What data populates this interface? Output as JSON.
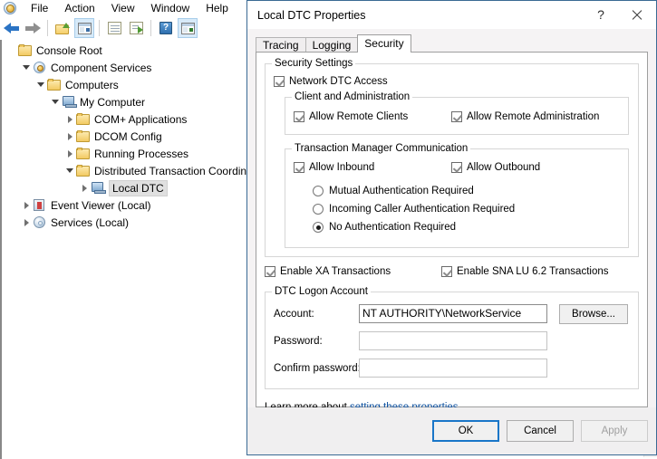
{
  "app": {
    "menu": [
      "File",
      "Action",
      "View",
      "Window",
      "Help"
    ],
    "app_icon": "component-services-icon",
    "toolbar": [
      {
        "name": "back-button",
        "icon": "arrow-left-icon"
      },
      {
        "name": "forward-button",
        "icon": "arrow-right-icon"
      },
      {
        "name": "up-one-level-button",
        "icon": "folder-up-icon"
      },
      {
        "name": "show-hide-console-tree-button",
        "icon": "console-tree-icon"
      },
      {
        "name": "properties-button",
        "icon": "properties-window-icon"
      },
      {
        "name": "export-list-button",
        "icon": "export-list-icon"
      },
      {
        "name": "help-button",
        "icon": "help-question-icon"
      },
      {
        "name": "new-window-button",
        "icon": "new-window-icon"
      }
    ]
  },
  "tree": [
    {
      "label": "Console Root",
      "depth": 0,
      "twisty": "none",
      "icon": "folder-icon",
      "selected": false
    },
    {
      "label": "Component Services",
      "depth": 1,
      "twisty": "open",
      "icon": "component-services-icon",
      "selected": false
    },
    {
      "label": "Computers",
      "depth": 2,
      "twisty": "open",
      "icon": "folder-icon",
      "selected": false
    },
    {
      "label": "My Computer",
      "depth": 3,
      "twisty": "open",
      "icon": "computer-icon",
      "selected": false
    },
    {
      "label": "COM+ Applications",
      "depth": 4,
      "twisty": "closed",
      "icon": "folder-icon",
      "selected": false
    },
    {
      "label": "DCOM Config",
      "depth": 4,
      "twisty": "closed",
      "icon": "folder-icon",
      "selected": false
    },
    {
      "label": "Running Processes",
      "depth": 4,
      "twisty": "closed",
      "icon": "folder-icon",
      "selected": false
    },
    {
      "label": "Distributed Transaction Coordin",
      "depth": 4,
      "twisty": "open",
      "icon": "folder-icon",
      "selected": false
    },
    {
      "label": "Local DTC",
      "depth": 5,
      "twisty": "closed",
      "icon": "computer-icon",
      "selected": true
    },
    {
      "label": "Event Viewer (Local)",
      "depth": 1,
      "twisty": "closed",
      "icon": "event-viewer-icon",
      "selected": false
    },
    {
      "label": "Services (Local)",
      "depth": 1,
      "twisty": "closed",
      "icon": "services-icon",
      "selected": false
    }
  ],
  "dialog": {
    "title": "Local DTC Properties",
    "help_glyph": "?",
    "close_glyph": "close-icon",
    "tabs": [
      {
        "label": "Tracing",
        "active": false
      },
      {
        "label": "Logging",
        "active": false
      },
      {
        "label": "Security",
        "active": true
      }
    ],
    "security": {
      "group_title": "Security Settings",
      "network_dtc_access": {
        "label": "Network DTC Access",
        "checked": true
      },
      "client_admin": {
        "title": "Client and Administration",
        "allow_remote_clients": {
          "label": "Allow Remote Clients",
          "checked": true
        },
        "allow_remote_administration": {
          "label": "Allow Remote Administration",
          "checked": true
        }
      },
      "tm_communication": {
        "title": "Transaction Manager Communication",
        "allow_inbound": {
          "label": "Allow Inbound",
          "checked": true
        },
        "allow_outbound": {
          "label": "Allow Outbound",
          "checked": true
        },
        "auth_options": [
          {
            "label": "Mutual Authentication Required",
            "selected": false
          },
          {
            "label": "Incoming Caller Authentication Required",
            "selected": false
          },
          {
            "label": "No Authentication Required",
            "selected": true
          }
        ]
      },
      "enable_xa": {
        "label": "Enable XA Transactions",
        "checked": true
      },
      "enable_sna": {
        "label": "Enable SNA LU 6.2 Transactions",
        "checked": true
      },
      "logon_account": {
        "title": "DTC Logon Account",
        "account_label": "Account:",
        "account_value": "NT AUTHORITY\\NetworkService",
        "browse_label": "Browse...",
        "password_label": "Password:",
        "password_value": "",
        "confirm_label": "Confirm password:",
        "confirm_value": ""
      },
      "learn_more_prefix": "Learn more about ",
      "learn_more_link": "setting these properties",
      "learn_more_suffix": "."
    },
    "buttons": {
      "ok": "OK",
      "cancel": "Cancel",
      "apply": "Apply",
      "apply_disabled": true
    }
  },
  "colors": {
    "accent": "#1976c8",
    "link": "#0b4f9e",
    "dialog_border": "#3a6a94",
    "scrollbar_thumb": "#5aa0de"
  }
}
